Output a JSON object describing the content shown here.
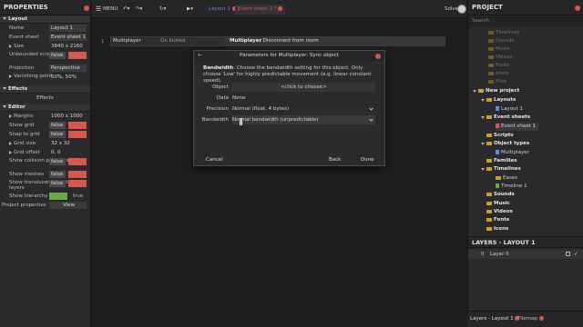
{
  "properties": {
    "title": "PROPERTIES",
    "section_layout": "Layout",
    "name_label": "Name",
    "name_value": "Layout 1",
    "eventsheet_label": "Event sheet",
    "eventsheet_value": "Event sheet 1",
    "size_label": "Size",
    "size_value": "3840 x 2160",
    "unbounded_label": "Unbounded scrolling",
    "unbounded_value": "false",
    "projection_label": "Projection",
    "projection_value": "Perspective",
    "vanishing_label": "Vanishing point",
    "vanishing_value": "50%, 50%",
    "section_effects": "Effects",
    "effects_button": "Effects",
    "section_editor": "Editor",
    "margins_label": "Margins",
    "margins_value": "1000 x 1000",
    "showgrid_label": "Show grid",
    "showgrid_value": "false",
    "snaptogrid_label": "Snap to grid",
    "snaptogrid_value": "false",
    "gridsize_label": "Grid size",
    "gridsize_value": "32 x 32",
    "gridoffset_label": "Grid offset",
    "gridoffset_value": "0, 0",
    "collision_label": "Show collision polygons",
    "collision_value": "false",
    "meshes_label": "Show meshes",
    "meshes_value": "false",
    "translucent_label": "Show translucent inactive layers",
    "translucent_value": "false",
    "hierarchy_label": "Show hierarchy",
    "hierarchy_value": "true",
    "projprops_label": "Project properties",
    "projprops_value": "View"
  },
  "toolbar": {
    "menu_label": "MENU",
    "tab_layout": "Layout 1",
    "tab_eventsheet": "Event sheet 1 *",
    "user_label": "Solve"
  },
  "sheet": {
    "row_number": "1",
    "object_name": "Multiplayer",
    "condition": "On kicked",
    "action_object": "Multiplayer",
    "action_text": ": Disconnect from room"
  },
  "dialog": {
    "title": "Parameters for Multiplayer: Sync object",
    "desc_bold": "Bandwidth",
    "desc_text": ": Choose the bandwidth setting for this object. Only choose 'Low' for highly predictable movement (e.g. linear constant speed).",
    "object_label": "Object",
    "object_value": "<click to choose>",
    "data_label": "Data",
    "data_value": "None",
    "precision_label": "Precision",
    "precision_value": "Normal (float, 4 bytes)",
    "bandwidth_label": "Bandwidth",
    "bandwidth_value": "Normal bandwidth (unpredictable)",
    "cancel": "Cancel",
    "back": "Back",
    "done": "Done"
  },
  "project": {
    "title": "PROJECT",
    "search_placeholder": "Search",
    "dim_items": [
      "Timelines",
      "Sounds",
      "Music",
      "Videos",
      "Fonts",
      "Icons",
      "Files"
    ],
    "root": "New project",
    "layouts": "Layouts",
    "layout1": "Layout 1",
    "eventsheets": "Event sheets",
    "eventsheet1": "Event sheet 1",
    "scripts": "Scripts",
    "objecttypes": "Object types",
    "multiplayer": "Multiplayer",
    "families": "Families",
    "timelines": "Timelines",
    "eases": "Eases",
    "timeline1": "Timeline 1",
    "sounds": "Sounds",
    "music": "Music",
    "videos": "Videos",
    "fonts": "Fonts",
    "icons": "Icons"
  },
  "layers": {
    "title": "LAYERS - LAYOUT 1",
    "layer_index": "0",
    "layer_name": "Layer 0"
  },
  "bottom_tabs": {
    "layers_tab": "Layers - Layout 1",
    "tilemap_tab": "Tilemap"
  },
  "colors": {
    "accent_blue": "#5b8fe0",
    "close_red": "#d9534f",
    "folder_yellow": "#c9a227",
    "toggle_green": "#6aa84f"
  }
}
